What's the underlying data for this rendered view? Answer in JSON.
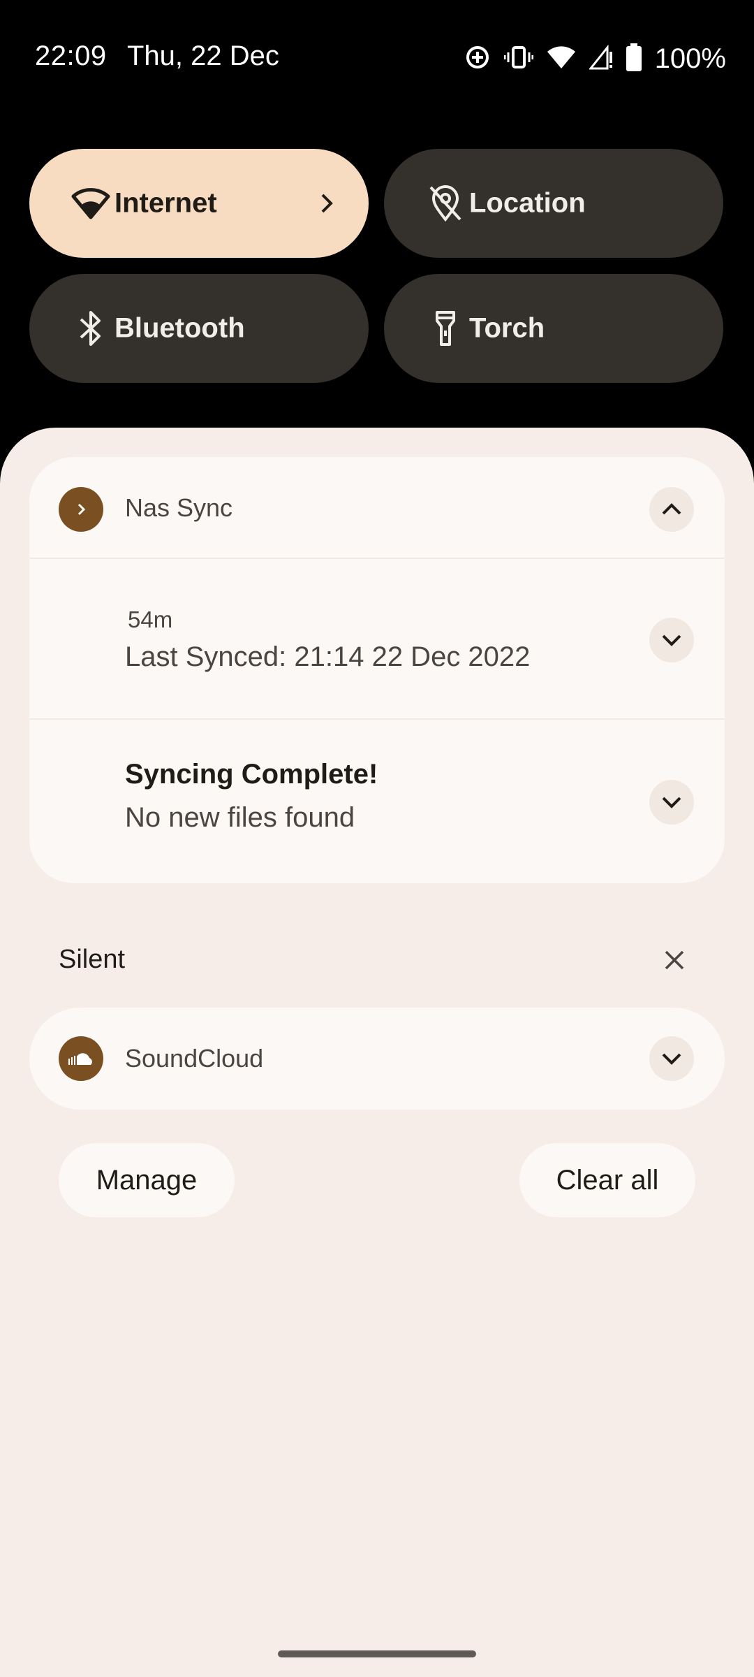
{
  "status_bar": {
    "time": "22:09",
    "date": "Thu, 22 Dec",
    "battery_text": "100%",
    "icons": [
      "data-saver-icon",
      "vibrate-icon",
      "wifi-icon",
      "signal-icon",
      "battery-icon"
    ]
  },
  "quick_tiles": [
    {
      "label": "Internet",
      "icon": "wifi-icon",
      "state": "on"
    },
    {
      "label": "Location",
      "icon": "location-off-icon",
      "state": "off"
    },
    {
      "label": "Bluetooth",
      "icon": "bluetooth-icon",
      "state": "off"
    },
    {
      "label": "Torch",
      "icon": "torch-icon",
      "state": "off"
    }
  ],
  "notification_group": {
    "app_name": "Nas Sync",
    "items": [
      {
        "time": "54m",
        "text": "Last Synced: 21:14 22 Dec 2022"
      },
      {
        "title": "Syncing Complete!",
        "text": "No new files found"
      }
    ]
  },
  "silent_section": {
    "label": "Silent",
    "app_name": "SoundCloud"
  },
  "actions": {
    "manage": "Manage",
    "clear_all": "Clear all"
  },
  "colors": {
    "tile_on": "#f7dcc2",
    "tile_off": "#34302c",
    "shade_bg": "#f6ede8",
    "card_bg": "#fcf8f5",
    "app_icon": "#7a4f21"
  }
}
